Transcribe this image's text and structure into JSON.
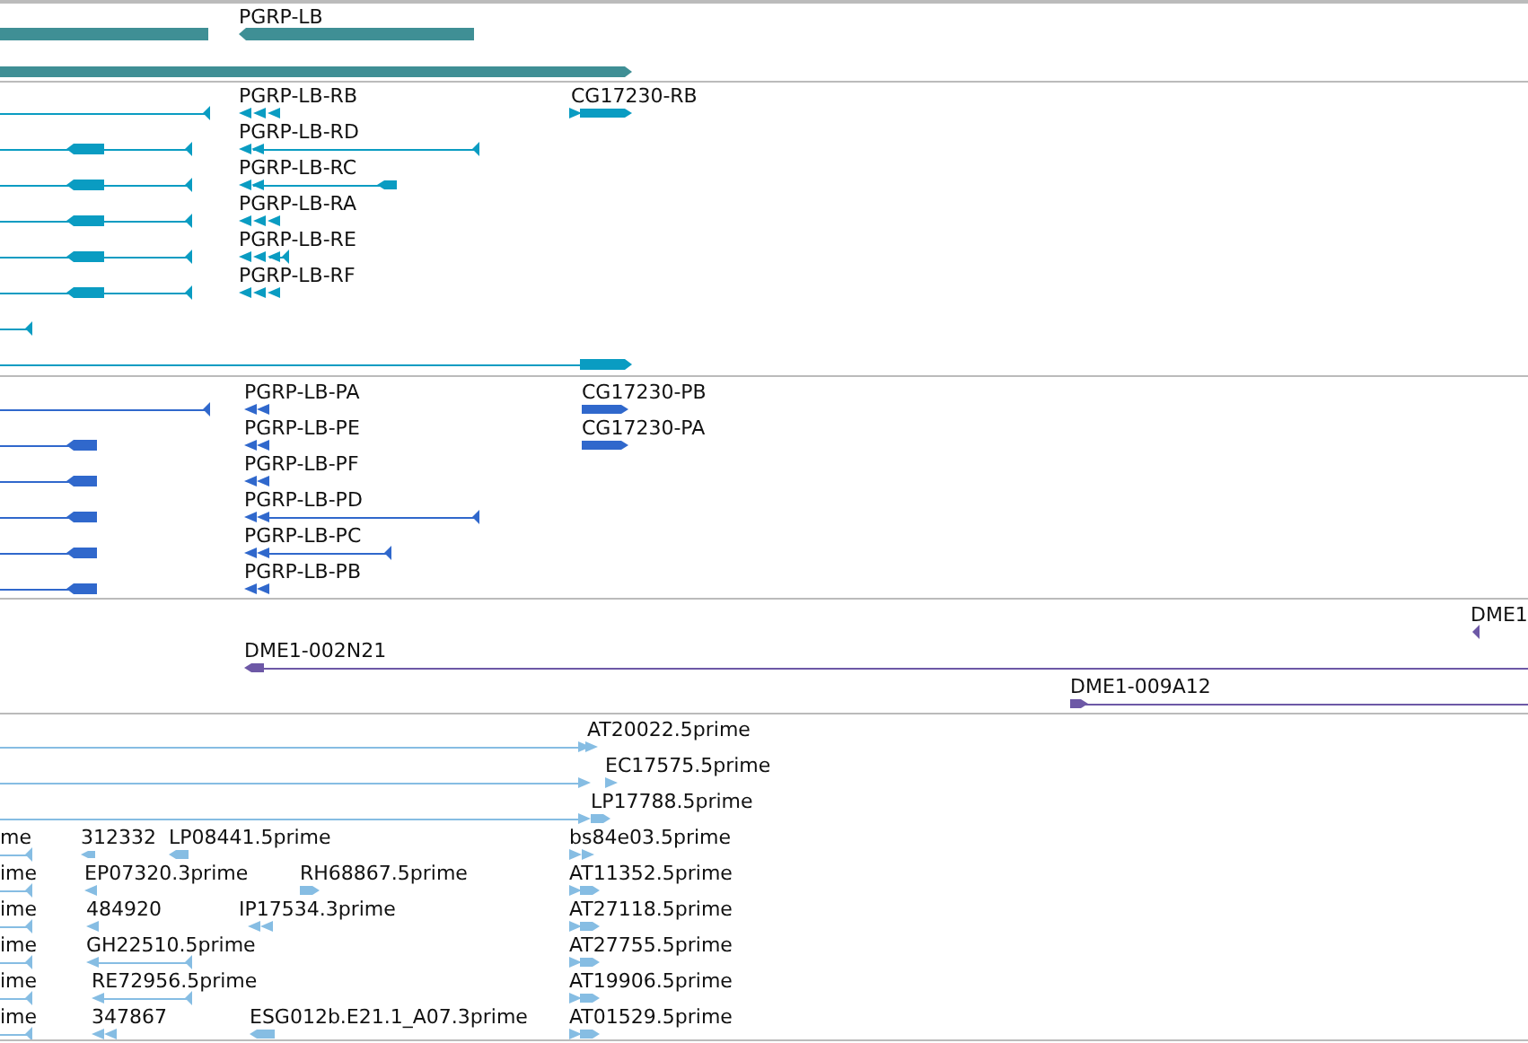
{
  "tracks": [
    {
      "color": "#3f8f95",
      "features": [
        {
          "label": "PGRP-LB"
        }
      ]
    },
    {
      "color": "#0a9cc2",
      "features": [
        {
          "label": "PGRP-LB-RB"
        },
        {
          "label": "CG17230-RB"
        },
        {
          "label": "PGRP-LB-RD"
        },
        {
          "label": "PGRP-LB-RC"
        },
        {
          "label": "PGRP-LB-RA"
        },
        {
          "label": "PGRP-LB-RE"
        },
        {
          "label": "PGRP-LB-RF"
        }
      ]
    },
    {
      "color": "#3068cc",
      "features": [
        {
          "label": "PGRP-LB-PA"
        },
        {
          "label": "CG17230-PB"
        },
        {
          "label": "PGRP-LB-PE"
        },
        {
          "label": "CG17230-PA"
        },
        {
          "label": "PGRP-LB-PF"
        },
        {
          "label": "PGRP-LB-PD"
        },
        {
          "label": "PGRP-LB-PC"
        },
        {
          "label": "PGRP-LB-PB"
        }
      ]
    },
    {
      "color": "#6d58a6",
      "features": [
        {
          "label": "DME1"
        },
        {
          "label": "DME1-002N21"
        },
        {
          "label": "DME1-009A12"
        }
      ]
    },
    {
      "color": "#86bde3",
      "features": [
        {
          "label": "AT20022.5prime"
        },
        {
          "label": "EC17575.5prime"
        },
        {
          "label": "LP17788.5prime"
        },
        {
          "label": "me"
        },
        {
          "label": "312332"
        },
        {
          "label": "LP08441.5prime"
        },
        {
          "label": "bs84e03.5prime"
        },
        {
          "label": "ime"
        },
        {
          "label": "EP07320.3prime"
        },
        {
          "label": "RH68867.5prime"
        },
        {
          "label": "AT11352.5prime"
        },
        {
          "label": "ime"
        },
        {
          "label": "484920"
        },
        {
          "label": "IP17534.3prime"
        },
        {
          "label": "AT27118.5prime"
        },
        {
          "label": "ime"
        },
        {
          "label": "GH22510.5prime"
        },
        {
          "label": "AT27755.5prime"
        },
        {
          "label": "ime"
        },
        {
          "label": "RE72956.5prime"
        },
        {
          "label": "AT19906.5prime"
        },
        {
          "label": "ime"
        },
        {
          "label": "347867"
        },
        {
          "label": "ESG012b.E21.1_A07.3prime"
        },
        {
          "label": "AT01529.5prime"
        }
      ]
    }
  ]
}
